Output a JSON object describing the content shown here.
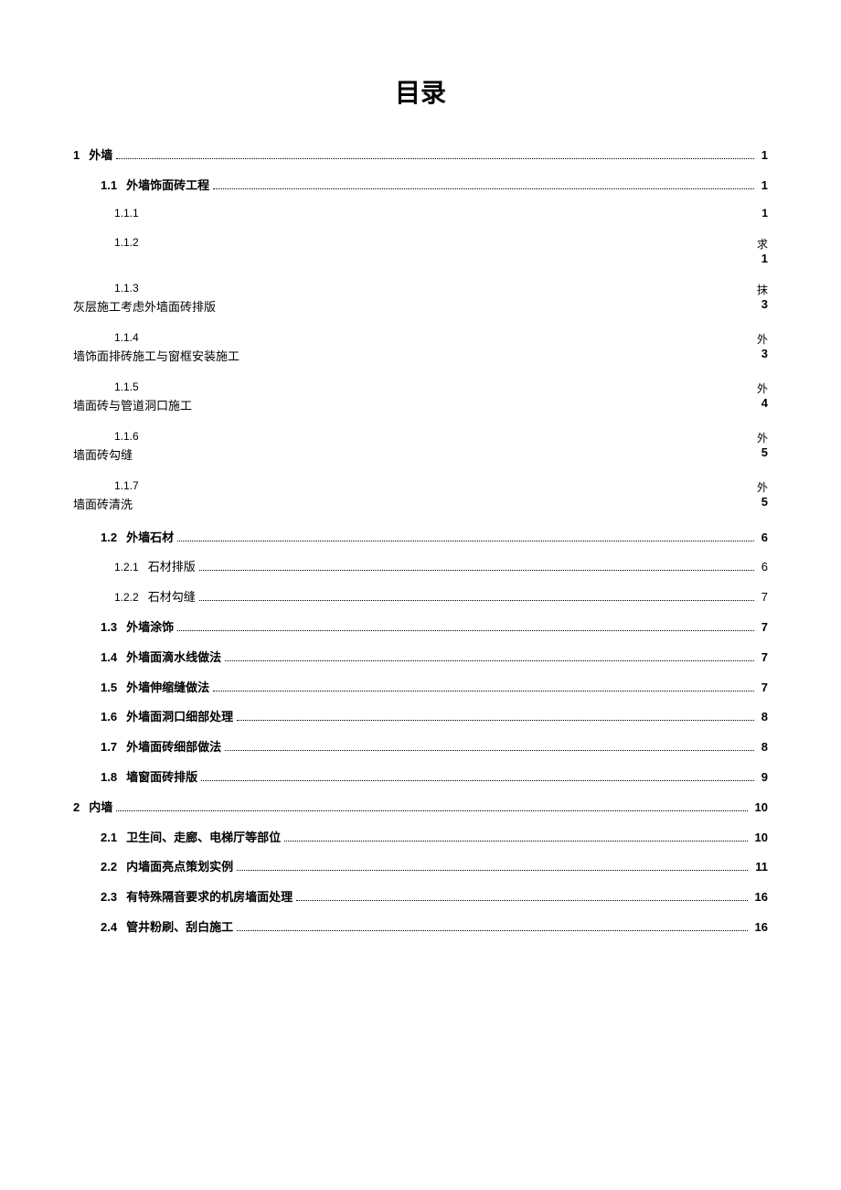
{
  "title": "目录",
  "toc": [
    {
      "type": "l1",
      "num": "1",
      "label": "外墙",
      "page": "1"
    },
    {
      "type": "l2",
      "num": "1.1",
      "label": "外墙饰面砖工程",
      "page": "1"
    },
    {
      "type": "ml_simple",
      "num": "1.1.1",
      "page": "1"
    },
    {
      "type": "ml",
      "num": "1.1.2",
      "right1": "求",
      "label2": "",
      "page": "1"
    },
    {
      "type": "ml",
      "num": "1.1.3",
      "right1": "抹",
      "label2": "灰层施工考虑外墙面砖排版",
      "page": "3"
    },
    {
      "type": "ml",
      "num": "1.1.4",
      "right1": "外",
      "label2": "墙饰面排砖施工与窗框安装施工",
      "page": "3"
    },
    {
      "type": "ml",
      "num": "1.1.5",
      "right1": "外",
      "label2": "墙面砖与管道洞口施工",
      "page": "4"
    },
    {
      "type": "ml",
      "num": "1.1.6",
      "right1": "外",
      "label2": "墙面砖勾缝",
      "page": "5"
    },
    {
      "type": "ml",
      "num": "1.1.7",
      "right1": "外",
      "label2": "墙面砖清洗",
      "page": "5"
    },
    {
      "type": "l2",
      "num": "1.2",
      "label": "外墙石材",
      "page": "6"
    },
    {
      "type": "l3",
      "num": "1.2.1",
      "label": "石材排版",
      "page": "6"
    },
    {
      "type": "l3",
      "num": "1.2.2",
      "label": "石材勾缝",
      "page": "7"
    },
    {
      "type": "l2",
      "num": "1.3",
      "label": "外墙涂饰",
      "page": "7"
    },
    {
      "type": "l2",
      "num": "1.4",
      "label": "外墙面滴水线做法",
      "page": "7"
    },
    {
      "type": "l2",
      "num": "1.5",
      "label": "外墙伸缩缝做法",
      "page": "7"
    },
    {
      "type": "l2",
      "num": "1.6",
      "label": "外墙面洞口细部处理",
      "page": "8"
    },
    {
      "type": "l2",
      "num": "1.7",
      "label": "外墙面砖细部做法",
      "page": "8"
    },
    {
      "type": "l2",
      "num": "1.8",
      "label": "墙窗面砖排版",
      "page": "9"
    },
    {
      "type": "l1",
      "num": "2",
      "label": "内墙",
      "page": "10"
    },
    {
      "type": "l2",
      "num": "2.1",
      "label": "卫生间、走廊、电梯厅等部位",
      "page": "10"
    },
    {
      "type": "l2",
      "num": "2.2",
      "label": "内墙面亮点策划实例",
      "page": "11"
    },
    {
      "type": "l2",
      "num": "2.3",
      "label": "有特殊隔音要求的机房墙面处理",
      "page": "16"
    },
    {
      "type": "l2",
      "num": "2.4",
      "label": "管井粉刷、刮白施工",
      "page": "16"
    }
  ]
}
